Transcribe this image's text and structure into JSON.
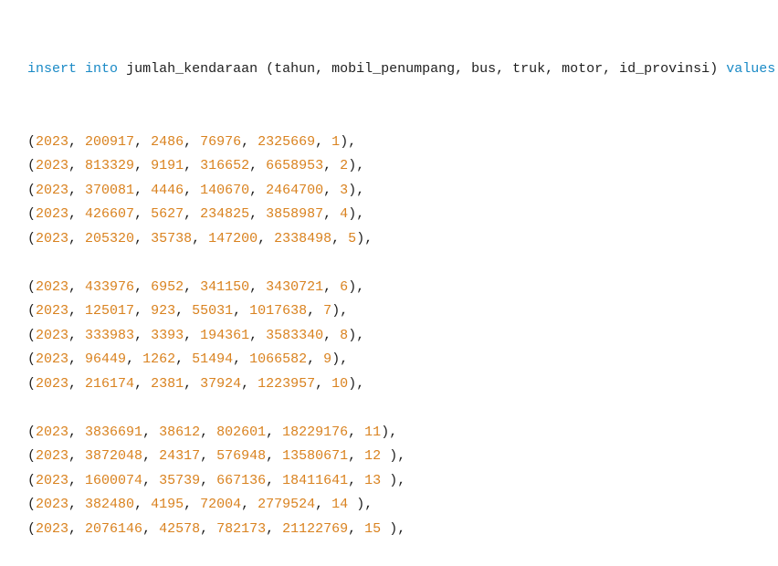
{
  "colors": {
    "keyword": "#1a8ac6",
    "number": "#d9821f",
    "text": "#1f1f1f"
  },
  "header": {
    "kw_insert": "insert",
    "kw_into": "into",
    "table": "jumlah_kendaraan",
    "columns": "(tahun, mobil_penumpang, bus, truk, motor, id_provinsi)",
    "kw_values": "values"
  },
  "groups": [
    [
      {
        "values": [
          "2023",
          "200917",
          "2486",
          "76976",
          "2325669",
          "1"
        ],
        "close": "),"
      },
      {
        "values": [
          "2023",
          "813329",
          "9191",
          "316652",
          "6658953",
          "2"
        ],
        "close": "),"
      },
      {
        "values": [
          "2023",
          "370081",
          "4446",
          "140670",
          "2464700",
          "3"
        ],
        "close": "),"
      },
      {
        "values": [
          "2023",
          "426607",
          "5627",
          "234825",
          "3858987",
          "4"
        ],
        "close": "),"
      },
      {
        "values": [
          "2023",
          "205320",
          "35738",
          "147200",
          "2338498",
          "5"
        ],
        "close": "),"
      }
    ],
    [
      {
        "values": [
          "2023",
          "433976",
          "6952",
          "341150",
          "3430721",
          "6"
        ],
        "close": "),"
      },
      {
        "values": [
          "2023",
          "125017",
          "923",
          "55031",
          "1017638",
          "7"
        ],
        "close": "),"
      },
      {
        "values": [
          "2023",
          "333983",
          "3393",
          "194361",
          "3583340",
          "8"
        ],
        "close": "),"
      },
      {
        "values": [
          "2023",
          "96449",
          "1262",
          "51494",
          "1066582",
          "9"
        ],
        "close": "),"
      },
      {
        "values": [
          "2023",
          "216174",
          "2381",
          "37924",
          "1223957",
          "10"
        ],
        "close": "),"
      }
    ],
    [
      {
        "values": [
          "2023",
          "3836691",
          "38612",
          "802601",
          "18229176",
          "11"
        ],
        "close": "),"
      },
      {
        "values": [
          "2023",
          "3872048",
          "24317",
          "576948",
          "13580671",
          "12"
        ],
        "close": " ),"
      },
      {
        "values": [
          "2023",
          "1600074",
          "35739",
          "667136",
          "18411641",
          "13"
        ],
        "close": " ),"
      },
      {
        "values": [
          "2023",
          "382480",
          "4195",
          "72004",
          "2779524",
          "14"
        ],
        "close": " ),"
      },
      {
        "values": [
          "2023",
          "2076146",
          "42578",
          "782173",
          "21122769",
          "15"
        ],
        "close": " ),"
      }
    ]
  ]
}
